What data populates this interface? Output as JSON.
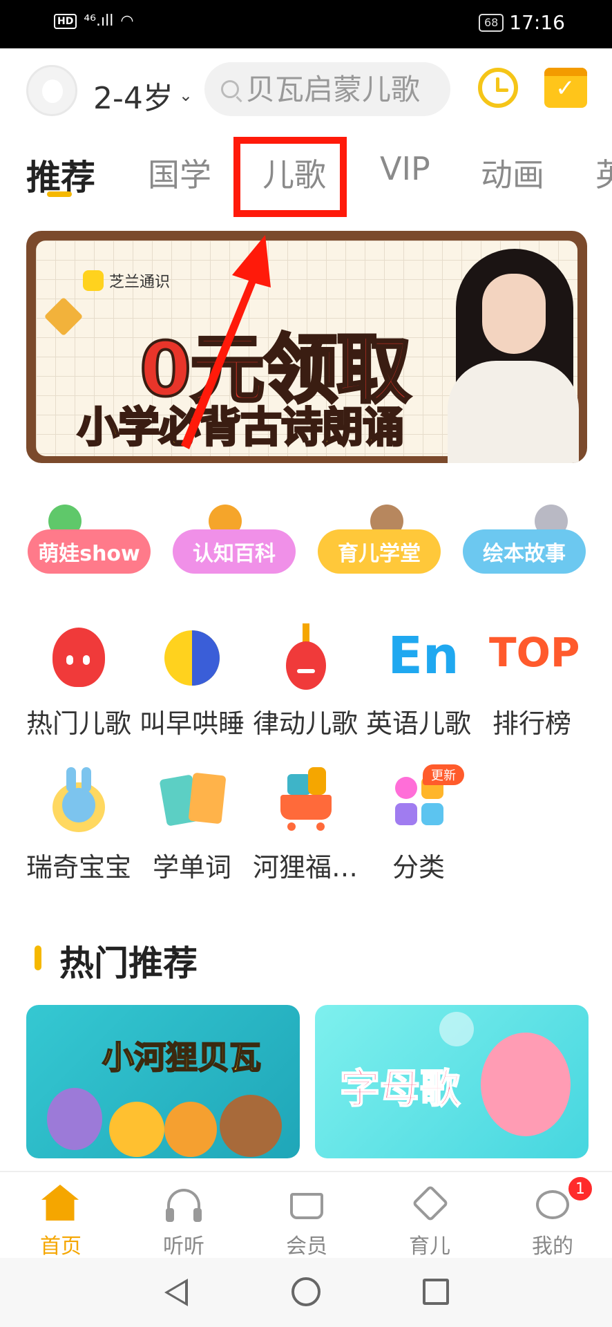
{
  "status_bar": {
    "time": "17:16",
    "battery": "68",
    "hd": "HD",
    "signal": "⁴⁶.ıll"
  },
  "header": {
    "age_selector": "2-4岁",
    "search_placeholder": "贝瓦启蒙儿歌"
  },
  "tabs": [
    "推荐",
    "国学",
    "儿歌",
    "VIP",
    "动画"
  ],
  "banner": {
    "brand": "芝兰通识",
    "headline": "0元领取",
    "subline": "小学必背古诗朗诵"
  },
  "pills": [
    {
      "label": "萌娃show",
      "color": "#ff7a8a"
    },
    {
      "label": "认知百科",
      "color": "#f090e8"
    },
    {
      "label": "育儿学堂",
      "color": "#ffc83a"
    },
    {
      "label": "绘本故事",
      "color": "#6cc8f0"
    }
  ],
  "grid_row1": [
    "热门儿歌",
    "叫早哄睡",
    "律动儿歌",
    "英语儿歌",
    "排行榜"
  ],
  "grid_row2": [
    "瑞奇宝宝",
    "学单词",
    "河狸福…",
    "分类"
  ],
  "grid_icon_texts": {
    "english": "En",
    "top": "TOP"
  },
  "update_badge": "更新",
  "section_title": "热门推荐",
  "cards": [
    {
      "title": "小河狸贝瓦"
    },
    {
      "title": "字母歌"
    }
  ],
  "bottom_nav": [
    "首页",
    "听听",
    "会员",
    "育儿",
    "我的"
  ],
  "bottom_nav_badge": "1",
  "colors": {
    "accent": "#f5b800",
    "annotation": "#ff1a0a"
  }
}
